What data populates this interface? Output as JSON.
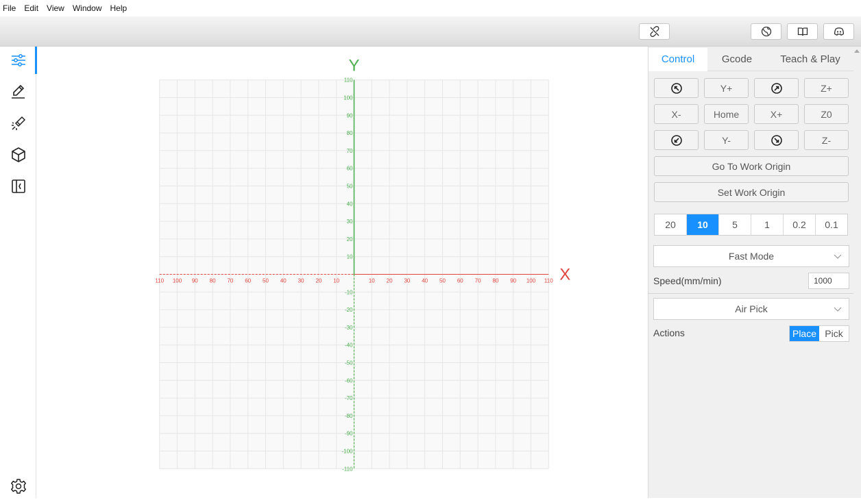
{
  "menu": [
    "File",
    "Edit",
    "View",
    "Window",
    "Help"
  ],
  "toolbar": {
    "icons": [
      "disconnect-icon",
      "globe-icon",
      "book-icon",
      "discord-icon"
    ]
  },
  "sidebar": {
    "items": [
      {
        "icon": "sliders-icon",
        "active": true
      },
      {
        "icon": "pencil-icon",
        "active": false
      },
      {
        "icon": "laser-icon",
        "active": false
      },
      {
        "icon": "cube-icon",
        "active": false
      },
      {
        "icon": "book-code-icon",
        "active": false
      }
    ],
    "settings_icon": "gear-icon"
  },
  "canvas": {
    "x_axis_label": "X",
    "y_axis_label": "Y",
    "x_range": [
      -110,
      110
    ],
    "y_range": [
      -110,
      110
    ],
    "tick_step": 10,
    "colors": {
      "x_axis": "#e0443c",
      "y_axis": "#4caf50",
      "grid": "#e6e6e6"
    }
  },
  "panel": {
    "tabs": [
      "Control",
      "Gcode",
      "Teach & Play"
    ],
    "active_tab": "Control",
    "jog": {
      "y_plus": "Y+",
      "z_plus": "Z+",
      "x_minus": "X-",
      "home": "Home",
      "x_plus": "X+",
      "z_zero": "Z0",
      "y_minus": "Y-",
      "z_minus": "Z-",
      "diag_icons": [
        "arrow-up-left-icon",
        "arrow-up-right-icon",
        "arrow-down-left-icon",
        "arrow-down-right-icon"
      ]
    },
    "go_to_work_origin": "Go To Work Origin",
    "set_work_origin": "Set Work Origin",
    "step_sizes": [
      "20",
      "10",
      "5",
      "1",
      "0.2",
      "0.1"
    ],
    "active_step": "10",
    "mode_select": "Fast Mode",
    "speed_label": "Speed(mm/min)",
    "speed_value": "1000",
    "tool_select": "Air Pick",
    "actions_label": "Actions",
    "action_place": "Place",
    "action_pick": "Pick",
    "active_action": "Place",
    "accent": "#1890ff"
  }
}
